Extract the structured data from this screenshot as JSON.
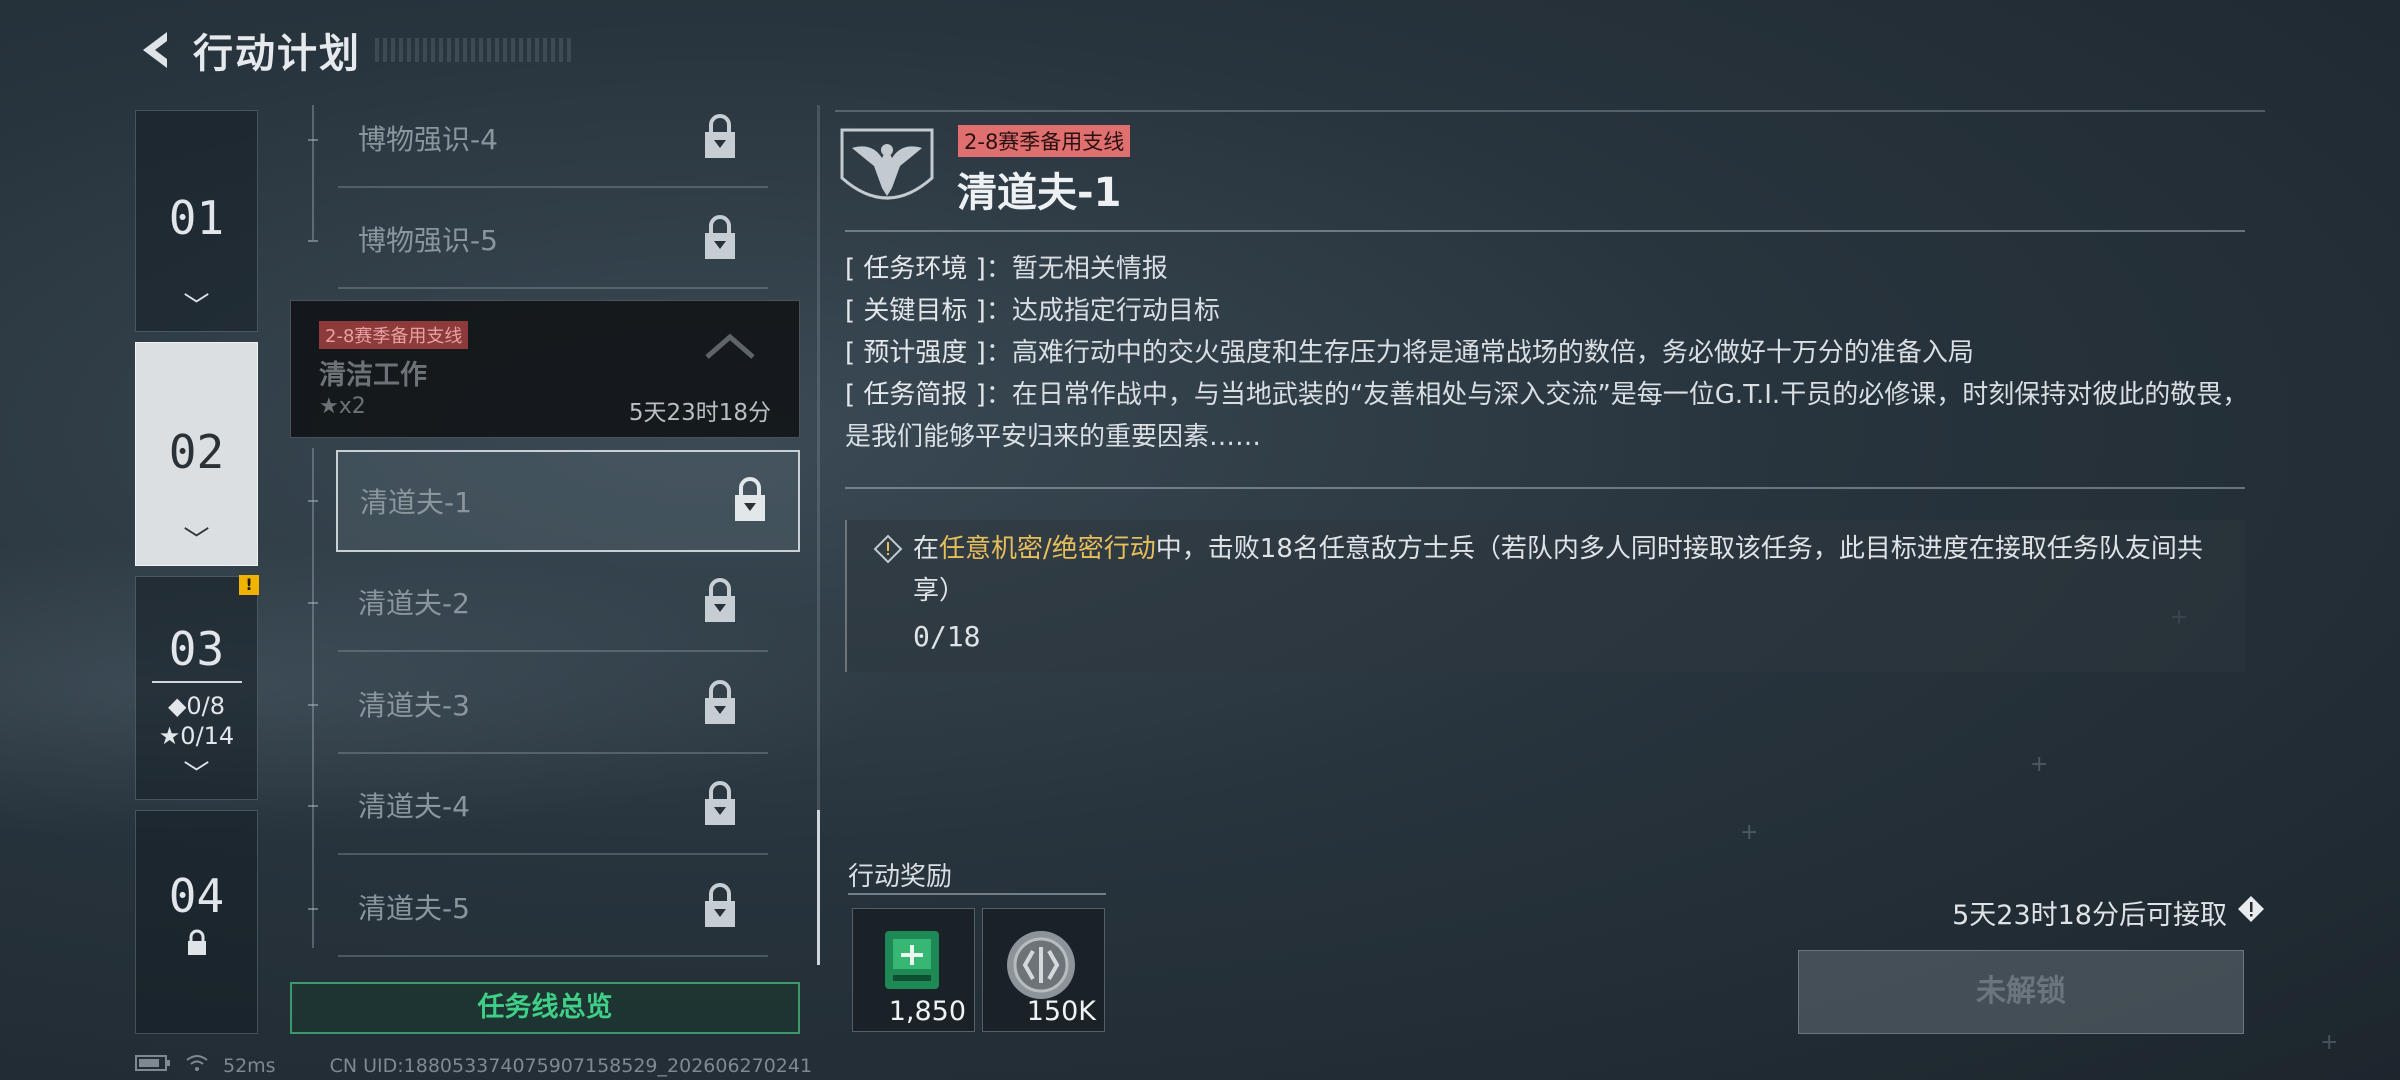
{
  "header": {
    "title": "行动计划"
  },
  "chapters": [
    {
      "num": "01"
    },
    {
      "num": "02"
    },
    {
      "num": "03",
      "diamond_stat": "◆0/8",
      "star_stat": "★0/14",
      "badge": "!"
    },
    {
      "num": "04"
    }
  ],
  "list": {
    "items_above": [
      {
        "name": "博物强识-4"
      },
      {
        "name": "博物强识-5"
      }
    ],
    "group": {
      "tag": "2-8赛季备用支线",
      "name": "清洁工作",
      "stars": "★x2",
      "time": "5天23时18分"
    },
    "items": [
      {
        "name": "清道夫-1"
      },
      {
        "name": "清道夫-2"
      },
      {
        "name": "清道夫-3"
      },
      {
        "name": "清道夫-4"
      },
      {
        "name": "清道夫-5"
      }
    ],
    "overview_label": "任务线总览"
  },
  "statusbar": {
    "ping": "52ms",
    "uid": "CN UID:18805337407590715​8529_202606270241"
  },
  "detail": {
    "tag": "2-8赛季备用支线",
    "name": "清道夫-1",
    "info": [
      {
        "label": "[ 任务环境 ]",
        "value": "暂无相关情报"
      },
      {
        "label": "[ 关键目标 ]",
        "value": "达成指定行动目标"
      },
      {
        "label": "[ 预计强度 ]",
        "value": "高难行动中的交火强度和生存压力将是通常战场的数倍，务必做好十万分的准备入局"
      },
      {
        "label": "[ 任务简报 ]",
        "value": "在日常作战中，与当地武装的“友善相处与深入交流”是每一位G.T.I.干员的必修课，时刻保持对彼此的敬畏，是我们能够平安归来的重要因素……"
      }
    ],
    "objective": {
      "prefix": "在",
      "highlight": "任意机密/绝密行动",
      "suffix": "中，击败18名任意敌方士兵（若队内多人同时接取该任务，此目标进度在接取任务队友间共享）",
      "progress": "0/18"
    },
    "reward_label": "行动奖励",
    "rewards": [
      {
        "icon": "currency-green-icon",
        "amount": "1,850"
      },
      {
        "icon": "coin-silver-icon",
        "amount": "150K"
      }
    ],
    "available_text": "5天23时18分后可接取",
    "unlock_label": "未解锁"
  },
  "colors": {
    "accent_green": "#3fcf86",
    "tag_red": "#e06f6f",
    "highlight_gold": "#e6bf5a"
  }
}
